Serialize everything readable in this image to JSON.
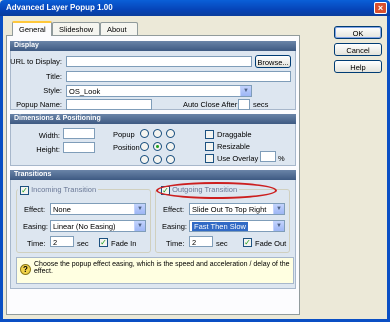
{
  "window": {
    "title": "Advanced Layer Popup 1.00",
    "close": "×"
  },
  "tabs": [
    "General",
    "Slideshow",
    "About"
  ],
  "side_buttons": {
    "ok": "OK",
    "cancel": "Cancel",
    "help": "Help"
  },
  "display": {
    "header": "Display",
    "url_label": "URL to Display:",
    "url_value": "",
    "browse": "Browse...",
    "title_label": "Title:",
    "title_value": "",
    "style_label": "Style:",
    "style_value": "OS_Look",
    "popup_name_label": "Popup Name:",
    "popup_name_value": "",
    "auto_close_label": "Auto Close After",
    "auto_close_value": "",
    "secs": "secs"
  },
  "dims": {
    "header": "Dimensions & Positioning",
    "width_label": "Width:",
    "height_label": "Height:",
    "popup_label": "Popup",
    "position_label": "Position",
    "position_selected": "center",
    "draggable": "Draggable",
    "resizable": "Resizable",
    "use_overlay": "Use Overlay",
    "overlay_value": "",
    "percent": "%"
  },
  "transitions": {
    "header": "Transitions",
    "incoming": {
      "title": "Incoming Transition",
      "checked": true,
      "effect_label": "Effect:",
      "effect": "None",
      "easing_label": "Easing:",
      "easing": "Linear (No Easing)",
      "time_label": "Time:",
      "time": "2",
      "sec": "sec",
      "fade_label": "Fade In",
      "fade": true
    },
    "outgoing": {
      "title": "Outgoing Transition",
      "checked": true,
      "effect_label": "Effect:",
      "effect": "Slide Out To Top Right",
      "easing_label": "Easing:",
      "easing": "Fast Then Slow",
      "time_label": "Time:",
      "time": "2",
      "sec": "sec",
      "fade_label": "Fade Out",
      "fade": true
    }
  },
  "hint": {
    "icon": "?",
    "text": "Choose the popup effect easing, which is the speed and acceleration / delay of the effect."
  },
  "colors": {
    "titlebar": "#0a4fc4",
    "section_header": "#4f6b92",
    "highlight": "#316ac5",
    "annotation": "#cc1f1f"
  },
  "glyphs": {
    "check": "✓",
    "arrow": "▼"
  }
}
